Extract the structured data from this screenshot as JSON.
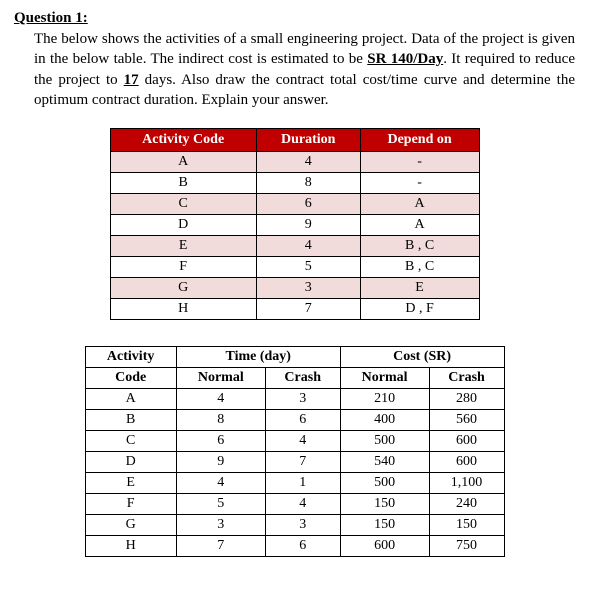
{
  "question": {
    "title": "Question 1:",
    "body_p1": "The below shows the activities of a small engineering project. Data of the project is given in the below table. The indirect cost is estimated to be ",
    "rate": "SR 140/Day",
    "body_p2": ". It required to reduce the project to ",
    "days": "17",
    "body_p3": " days. Also draw the contract total cost/time curve and determine the optimum contract duration. Explain your answer."
  },
  "table1": {
    "headers": [
      "Activity Code",
      "Duration",
      "Depend on"
    ],
    "rows": [
      [
        "A",
        "4",
        "-"
      ],
      [
        "B",
        "8",
        "-"
      ],
      [
        "C",
        "6",
        "A"
      ],
      [
        "D",
        "9",
        "A"
      ],
      [
        "E",
        "4",
        "B , C"
      ],
      [
        "F",
        "5",
        "B , C"
      ],
      [
        "G",
        "3",
        "E"
      ],
      [
        "H",
        "7",
        "D , F"
      ]
    ]
  },
  "table2": {
    "group_headers": [
      "Activity",
      "Time (day)",
      "Cost (SR)"
    ],
    "sub_headers": [
      "Code",
      "Normal",
      "Crash",
      "Normal",
      "Crash"
    ],
    "rows": [
      [
        "A",
        "4",
        "3",
        "210",
        "280"
      ],
      [
        "B",
        "8",
        "6",
        "400",
        "560"
      ],
      [
        "C",
        "6",
        "4",
        "500",
        "600"
      ],
      [
        "D",
        "9",
        "7",
        "540",
        "600"
      ],
      [
        "E",
        "4",
        "1",
        "500",
        "1,100"
      ],
      [
        "F",
        "5",
        "4",
        "150",
        "240"
      ],
      [
        "G",
        "3",
        "3",
        "150",
        "150"
      ],
      [
        "H",
        "7",
        "6",
        "600",
        "750"
      ]
    ]
  },
  "chart_data": {
    "type": "table",
    "activities": [
      {
        "code": "A",
        "normal_time": 4,
        "crash_time": 3,
        "normal_cost": 210,
        "crash_cost": 280,
        "depends_on": []
      },
      {
        "code": "B",
        "normal_time": 8,
        "crash_time": 6,
        "normal_cost": 400,
        "crash_cost": 560,
        "depends_on": []
      },
      {
        "code": "C",
        "normal_time": 6,
        "crash_time": 4,
        "normal_cost": 500,
        "crash_cost": 600,
        "depends_on": [
          "A"
        ]
      },
      {
        "code": "D",
        "normal_time": 9,
        "crash_time": 7,
        "normal_cost": 540,
        "crash_cost": 600,
        "depends_on": [
          "A"
        ]
      },
      {
        "code": "E",
        "normal_time": 4,
        "crash_time": 1,
        "normal_cost": 500,
        "crash_cost": 1100,
        "depends_on": [
          "B",
          "C"
        ]
      },
      {
        "code": "F",
        "normal_time": 5,
        "crash_time": 4,
        "normal_cost": 150,
        "crash_cost": 240,
        "depends_on": [
          "B",
          "C"
        ]
      },
      {
        "code": "G",
        "normal_time": 3,
        "crash_time": 3,
        "normal_cost": 150,
        "crash_cost": 150,
        "depends_on": [
          "E"
        ]
      },
      {
        "code": "H",
        "normal_time": 7,
        "crash_time": 6,
        "normal_cost": 600,
        "crash_cost": 750,
        "depends_on": [
          "D",
          "F"
        ]
      }
    ],
    "indirect_cost_per_day": 140,
    "reduce_to_days": 17
  }
}
